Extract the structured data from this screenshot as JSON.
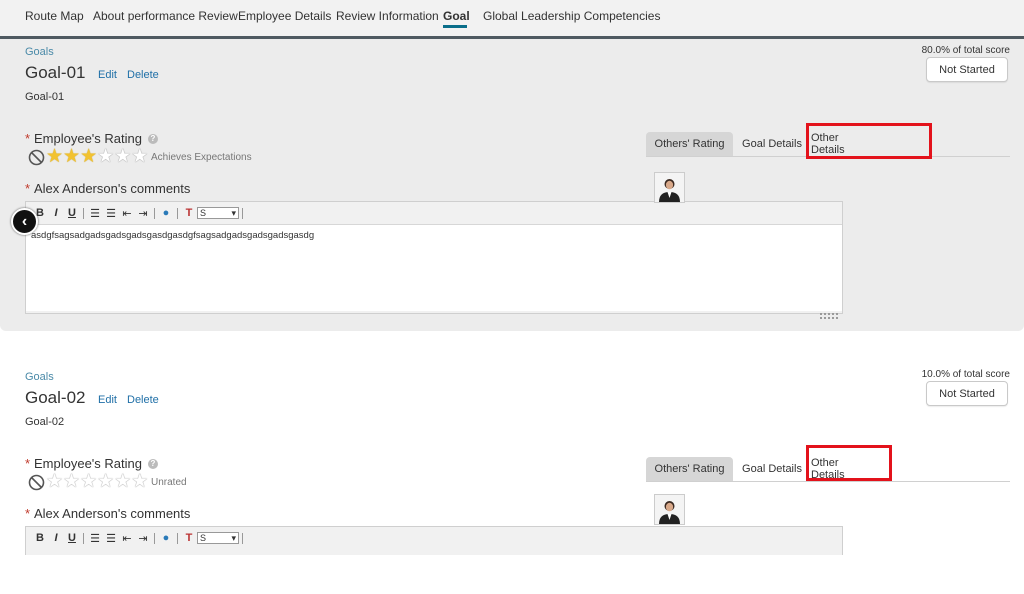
{
  "nav": {
    "items": [
      "Route Map",
      "About performance Review",
      "Employee Details",
      "Review Information",
      "Goal",
      "Global Leadership Competencies"
    ],
    "active": "Goal"
  },
  "goals": [
    {
      "breadcrumb": "Goals",
      "title": "Goal-01",
      "edit": "Edit",
      "delete": "Delete",
      "description": "Goal-01",
      "score": "80.0% of total score",
      "status": "Not Started",
      "rating_label": "Employee's Rating",
      "rating_value": 3,
      "rating_max": 6,
      "rating_text": "Achieves Expectations",
      "comments_label": "Alex Anderson's comments",
      "comment_text": "asdgfsagsadgadsgadsgadsgasdgasdgfsagsadgadsgadsgadsgasdg",
      "font_select": "S",
      "tabs": [
        "Others' Rating",
        "Goal Details",
        "Other Details"
      ]
    },
    {
      "breadcrumb": "Goals",
      "title": "Goal-02",
      "edit": "Edit",
      "delete": "Delete",
      "description": "Goal-02",
      "score": "10.0% of total score",
      "status": "Not Started",
      "rating_label": "Employee's Rating",
      "rating_value": 0,
      "rating_max": 6,
      "rating_text": "Unrated",
      "comments_label": "Alex Anderson's comments",
      "comment_text": "",
      "font_select": "S",
      "tabs": [
        "Others' Rating",
        "Goal Details",
        "Other Details"
      ]
    }
  ],
  "required_marker": "*",
  "colors": {
    "highlight": "#e3121b",
    "accent": "#0a6e8a",
    "link": "#1f6fa7"
  }
}
